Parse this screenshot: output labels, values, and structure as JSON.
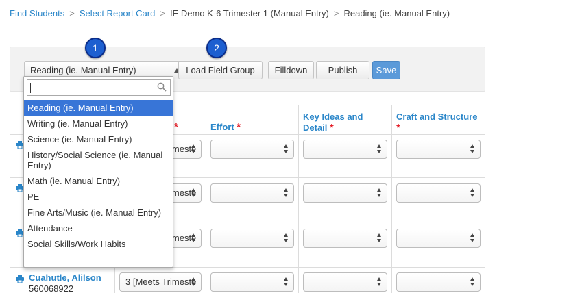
{
  "breadcrumb": [
    {
      "label": "Find Students",
      "link": true
    },
    {
      "label": "Select Report Card",
      "link": true
    },
    {
      "label": "IE Demo K-6 Trimester 1 (Manual Entry)",
      "link": false
    },
    {
      "label": "Reading (ie. Manual Entry)",
      "link": false
    }
  ],
  "breadcrumb_separator": ">",
  "toolbar": {
    "field_group_select": "Reading (ie. Manual Entry)",
    "load_label": "Load Field Group",
    "filldown_label": "Filldown",
    "publish_label": "Publish",
    "save_label": "Save"
  },
  "callouts": {
    "one": "1",
    "two": "2"
  },
  "dropdown": {
    "search_value": "",
    "options": [
      "Reading (ie. Manual Entry)",
      "Writing (ie. Manual Entry)",
      "Science (ie. Manual Entry)",
      "History/Social Science (ie. Manual Entry)",
      "Math (ie. Manual Entry)",
      "PE",
      "Fine Arts/Music (ie. Manual Entry)",
      "Attendance",
      "Social Skills/Work Habits"
    ],
    "selected_index": 0
  },
  "columns": {
    "effort": "Effort",
    "key_ideas": "Key Ideas and Detail",
    "craft": "Craft and Structure",
    "required_mark": "*"
  },
  "rows": [
    {
      "grade_value": "3 [Meets Trimeste"
    },
    {
      "grade_value": "3 [Meets Trimeste"
    },
    {
      "grade_value": "3 [Meets Trimeste"
    },
    {
      "grade_value": "3 [Meets Trimeste"
    }
  ],
  "student": {
    "name": "Cuahutle, Alilson",
    "id": "560068922"
  },
  "colors": {
    "link": "#2a86c9",
    "save": "#5b9ad9",
    "badge": "#1d5fd0",
    "selected_option": "#3875d7",
    "required": "#e4202a"
  }
}
